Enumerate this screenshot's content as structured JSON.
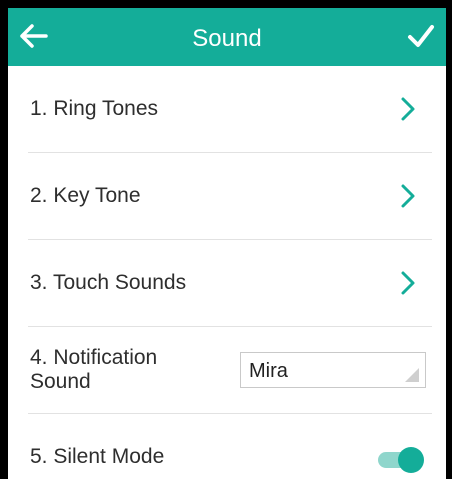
{
  "header": {
    "title": "Sound",
    "back_icon": "arrow-left-icon",
    "confirm_icon": "check-icon",
    "background_color": "#14ad99"
  },
  "items": [
    {
      "label": "1. Ring Tones",
      "control": "chevron-right-icon"
    },
    {
      "label": "2. Key Tone",
      "control": "chevron-right-icon"
    },
    {
      "label": "3. Touch Sounds",
      "control": "chevron-right-icon"
    },
    {
      "label_line1": "4. Notification",
      "label_line2": "Sound",
      "control": "dropdown",
      "value": "Mira"
    },
    {
      "label": "5. Silent Mode",
      "control": "toggle",
      "state": "on"
    }
  ],
  "accent_color": "#14ad99"
}
